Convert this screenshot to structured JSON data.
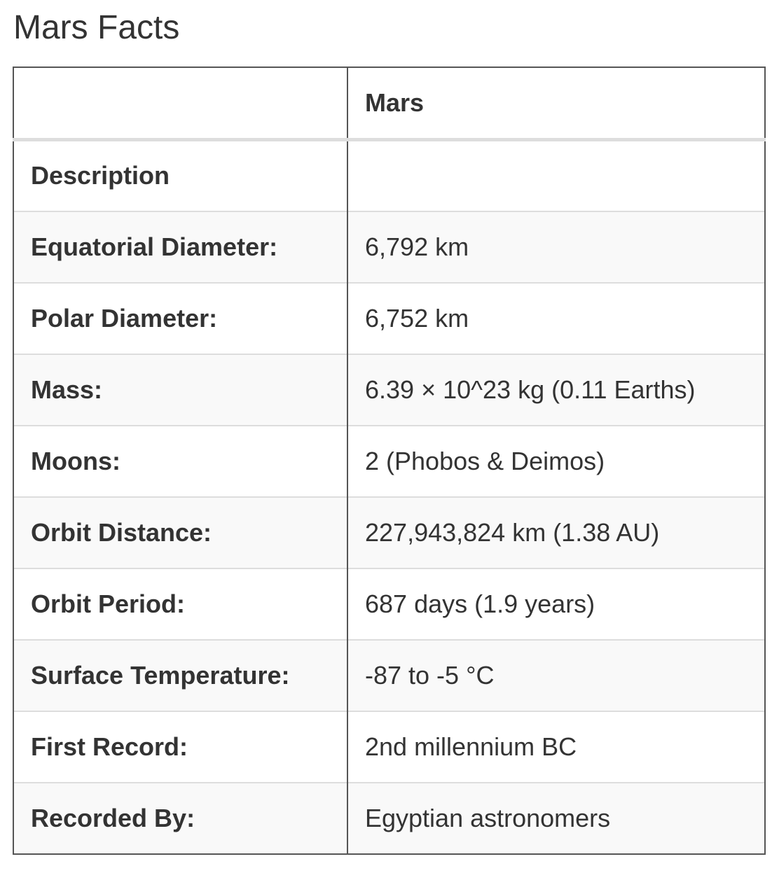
{
  "page": {
    "title": "Mars Facts"
  },
  "table": {
    "headers": [
      "",
      "Mars"
    ],
    "rows": [
      {
        "label": "Description",
        "value": ""
      },
      {
        "label": "Equatorial Diameter:",
        "value": "6,792 km"
      },
      {
        "label": "Polar Diameter:",
        "value": "6,752 km"
      },
      {
        "label": "Mass:",
        "value": "6.39 × 10^23 kg (0.11 Earths)"
      },
      {
        "label": "Moons:",
        "value": "2 (Phobos & Deimos)"
      },
      {
        "label": "Orbit Distance:",
        "value": "227,943,824 km (1.38 AU)"
      },
      {
        "label": "Orbit Period:",
        "value": "687 days (1.9 years)"
      },
      {
        "label": "Surface Temperature:",
        "value": "-87 to -5 °C"
      },
      {
        "label": "First Record:",
        "value": "2nd millennium BC"
      },
      {
        "label": "Recorded By:",
        "value": "Egyptian astronomers"
      }
    ]
  },
  "colors": {
    "text": "#333333",
    "outer_border": "#555555",
    "row_divider": "#dddddd",
    "stripe": "#f9f9f9"
  }
}
